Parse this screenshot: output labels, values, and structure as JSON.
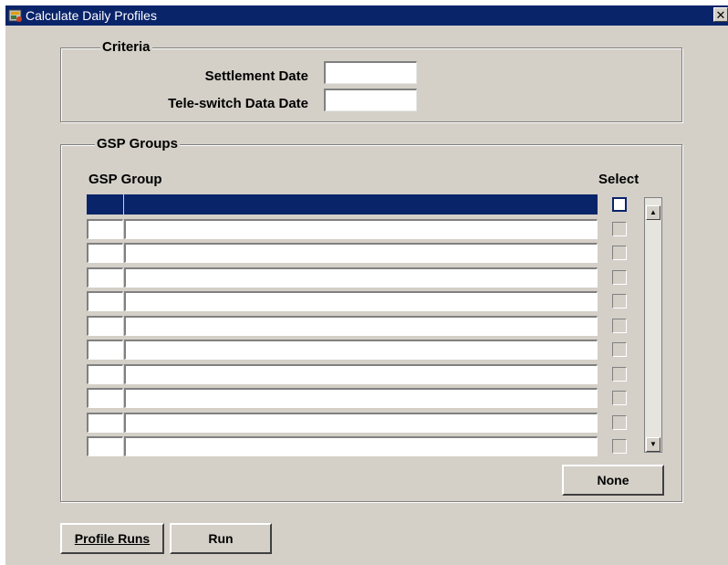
{
  "window": {
    "title": "Calculate Daily Profiles",
    "close_glyph": "✕",
    "icon": "app-form-icon"
  },
  "criteria": {
    "title": "Criteria",
    "settlement_date_label": "Settlement Date",
    "settlement_date_value": "",
    "teleswitch_date_label": "Tele-switch Data Date",
    "teleswitch_date_value": ""
  },
  "gsp_groups": {
    "title": "GSP Groups",
    "col_group": "GSP Group",
    "col_select": "Select",
    "rows": [
      {
        "code": "",
        "name": "",
        "selected": false
      },
      {
        "code": "",
        "name": "",
        "selected": false
      },
      {
        "code": "",
        "name": "",
        "selected": false
      },
      {
        "code": "",
        "name": "",
        "selected": false
      },
      {
        "code": "",
        "name": "",
        "selected": false
      },
      {
        "code": "",
        "name": "",
        "selected": false
      },
      {
        "code": "",
        "name": "",
        "selected": false
      },
      {
        "code": "",
        "name": "",
        "selected": false
      },
      {
        "code": "",
        "name": "",
        "selected": false
      },
      {
        "code": "",
        "name": "",
        "selected": false
      },
      {
        "code": "",
        "name": "",
        "selected": false
      }
    ],
    "none_button": "None"
  },
  "buttons": {
    "profile_runs": "Profile Runs",
    "run": "Run"
  },
  "colors": {
    "titlebar": "#0a246a",
    "selection": "#0a246a",
    "face": "#d4d0c8"
  }
}
